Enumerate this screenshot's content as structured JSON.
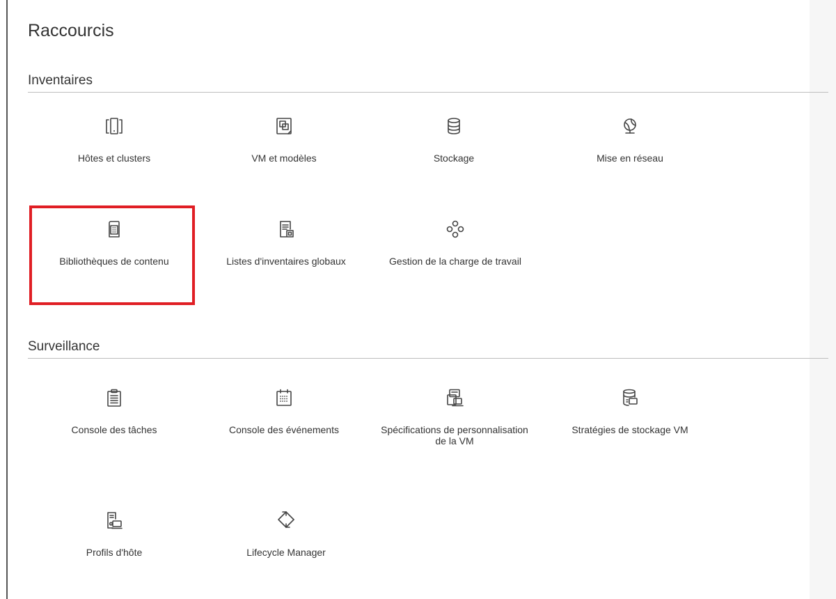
{
  "page": {
    "title": "Raccourcis"
  },
  "sections": {
    "inventaires": {
      "title": "Inventaires",
      "items": [
        {
          "label": "Hôtes et clusters",
          "icon": "hosts-clusters-icon"
        },
        {
          "label": "VM et modèles",
          "icon": "vm-templates-icon"
        },
        {
          "label": "Stockage",
          "icon": "storage-icon"
        },
        {
          "label": "Mise en réseau",
          "icon": "networking-icon"
        },
        {
          "label": "Bibliothèques de contenu",
          "icon": "content-library-icon"
        },
        {
          "label": "Listes d'inventaires globaux",
          "icon": "global-inventory-lists-icon"
        },
        {
          "label": "Gestion de la charge de travail",
          "icon": "workload-management-icon"
        }
      ]
    },
    "surveillance": {
      "title": "Surveillance",
      "items": [
        {
          "label": "Console des tâches",
          "icon": "task-console-icon"
        },
        {
          "label": "Console des événements",
          "icon": "event-console-icon"
        },
        {
          "label": "Spécifications de personnalisation de la VM",
          "icon": "vm-customization-specs-icon"
        },
        {
          "label": "Stratégies de stockage VM",
          "icon": "vm-storage-policies-icon"
        },
        {
          "label": "Profils d'hôte",
          "icon": "host-profiles-icon"
        },
        {
          "label": "Lifecycle Manager",
          "icon": "lifecycle-manager-icon"
        }
      ]
    }
  },
  "highlight": {
    "target": "Bibliothèques de contenu",
    "color": "#e01e24"
  }
}
